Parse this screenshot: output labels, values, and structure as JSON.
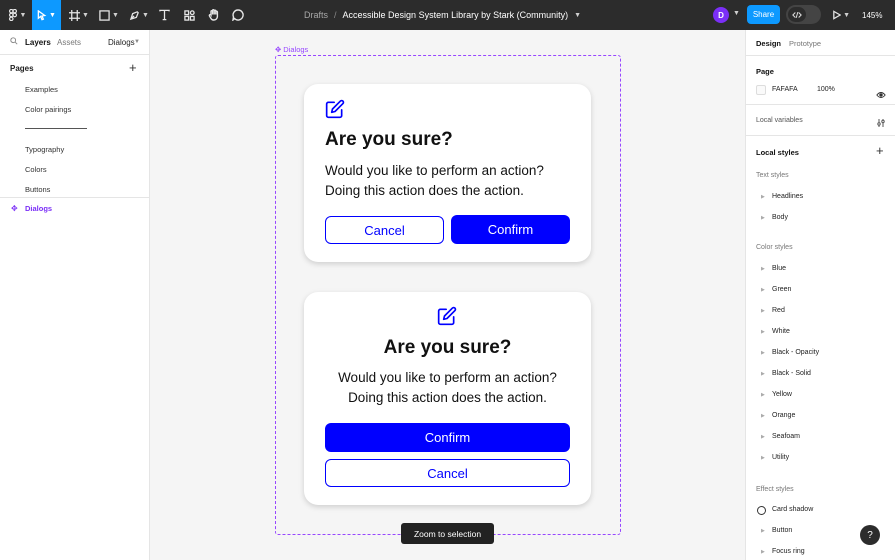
{
  "toolbar": {
    "breadcrumb_folder": "Drafts",
    "breadcrumb_separator": "/",
    "file_name": "Accessible Design System Library by Stark (Community)",
    "avatar_initial": "D",
    "share_label": "Share",
    "zoom_level": "145%"
  },
  "left_panel": {
    "tabs": {
      "layers": "Layers",
      "assets": "Assets",
      "page_picker": "Dialogs"
    },
    "pages_header": "Pages",
    "pages": [
      "Examples",
      "Color pairings",
      "Typography",
      "Colors",
      "Buttons",
      "Dialogs"
    ],
    "active_page": "Dialogs"
  },
  "canvas": {
    "frame_label": "Dialogs",
    "dialog_top": {
      "title": "Are you sure?",
      "body_line1": "Would you like to perform an action?",
      "body_line2": "Doing this action does the action.",
      "cancel_label": "Cancel",
      "confirm_label": "Confirm"
    },
    "dialog_bottom": {
      "title": "Are you sure?",
      "body_line1": "Would you like to perform an action?",
      "body_line2": "Doing this action does the action.",
      "confirm_label": "Confirm",
      "cancel_label": "Cancel"
    },
    "tooltip": "Zoom to selection"
  },
  "right_panel": {
    "tabs": {
      "design": "Design",
      "prototype": "Prototype"
    },
    "page_section": "Page",
    "page_color": "FAFAFA",
    "page_opacity": "100%",
    "local_variables": "Local variables",
    "local_styles": "Local styles",
    "text_styles_header": "Text styles",
    "text_styles": [
      "Headlines",
      "Body"
    ],
    "color_styles_header": "Color styles",
    "color_styles": [
      "Blue",
      "Green",
      "Red",
      "White",
      "Black - Opacity",
      "Black - Solid",
      "Yellow",
      "Orange",
      "Seafoam",
      "Utility"
    ],
    "effect_styles_header": "Effect styles",
    "effect_styles": [
      "Card shadow",
      "Button",
      "Focus ring"
    ]
  },
  "help_label": "?",
  "colors": {
    "accent_blue": "#0000ff",
    "figma_blue": "#0d99ff",
    "frame_purple": "#9747ff",
    "toolbar_bg": "#2c2c2c"
  },
  "icons": [
    "figma-menu-icon",
    "move-tool-icon",
    "frame-tool-icon",
    "shape-tool-icon",
    "pen-tool-icon",
    "text-tool-icon",
    "resources-icon",
    "hand-tool-icon",
    "comment-tool-icon",
    "edit-icon",
    "eye-icon",
    "play-icon",
    "dev-mode-icon",
    "search-icon",
    "plus-icon",
    "variables-icon"
  ]
}
